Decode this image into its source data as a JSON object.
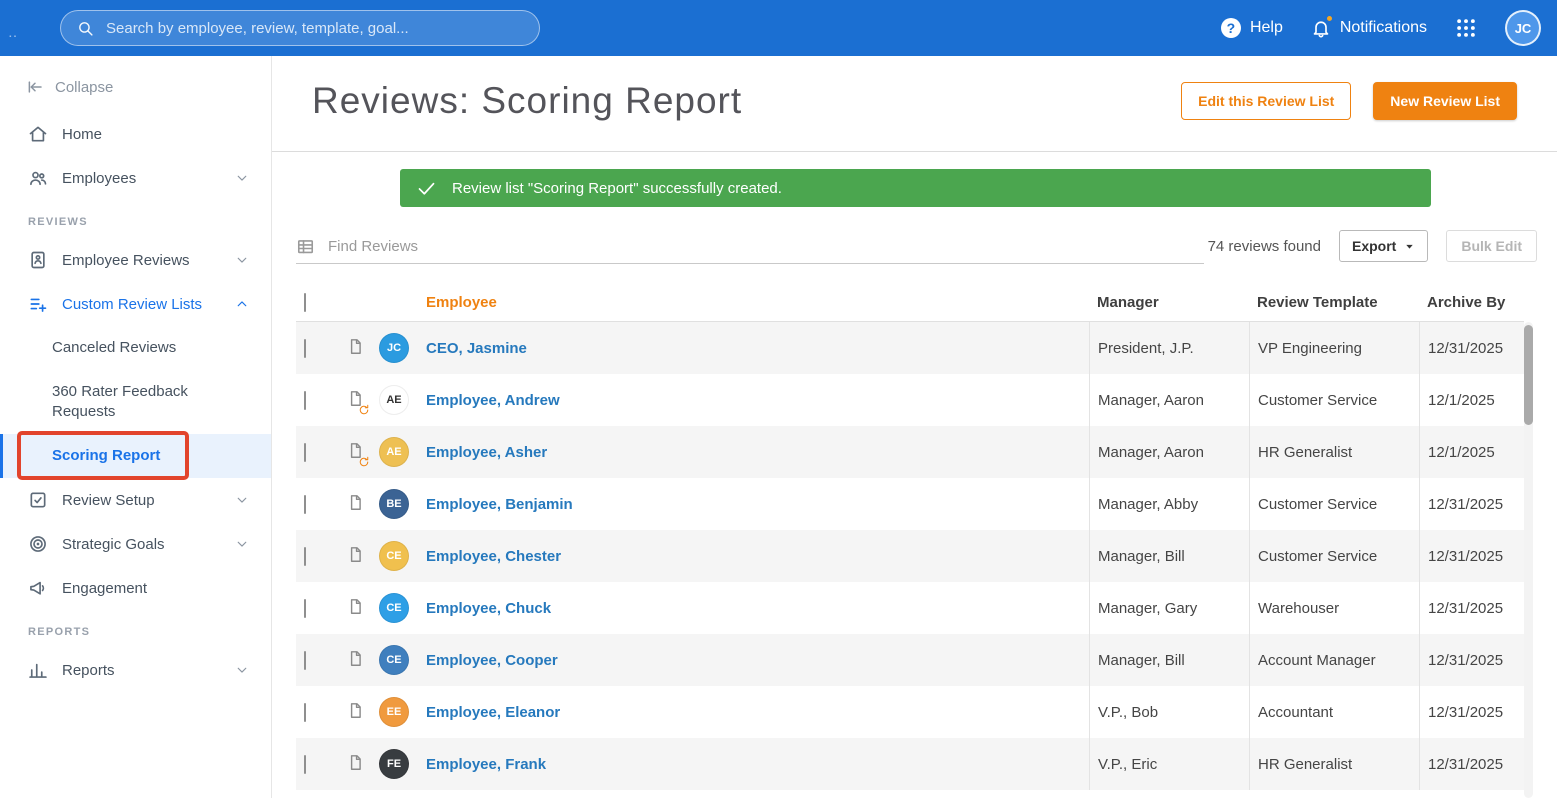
{
  "topbar": {
    "search_placeholder": "Search by employee, review, template, goal...",
    "help_label": "Help",
    "notifications_label": "Notifications",
    "avatar_initials": "JC"
  },
  "sidebar": {
    "collapse_label": "Collapse",
    "items": [
      {
        "type": "link",
        "icon": "home-icon",
        "label": "Home"
      },
      {
        "type": "link",
        "icon": "employees-icon",
        "label": "Employees",
        "chevron": "down"
      },
      {
        "type": "section",
        "label": "REVIEWS"
      },
      {
        "type": "link",
        "icon": "employee-reviews-icon",
        "label": "Employee Reviews",
        "chevron": "down"
      },
      {
        "type": "link",
        "icon": "custom-review-lists-icon",
        "label": "Custom Review Lists",
        "chevron": "up",
        "active": true
      },
      {
        "type": "sublink",
        "label": "Canceled Reviews"
      },
      {
        "type": "sublink",
        "label": "360 Rater Feedback Requests"
      },
      {
        "type": "sublink",
        "label": "Scoring Report",
        "selected": true,
        "annotated": true
      },
      {
        "type": "link",
        "icon": "review-setup-icon",
        "label": "Review Setup",
        "chevron": "down"
      },
      {
        "type": "link",
        "icon": "strategic-goals-icon",
        "label": "Strategic Goals",
        "chevron": "down"
      },
      {
        "type": "link",
        "icon": "engagement-icon",
        "label": "Engagement"
      },
      {
        "type": "section",
        "label": "REPORTS"
      },
      {
        "type": "link",
        "icon": "reports-icon",
        "label": "Reports",
        "chevron": "down"
      }
    ]
  },
  "page": {
    "title": "Reviews: Scoring Report",
    "edit_list_button": "Edit this Review List",
    "new_list_button": "New Review List",
    "success_message": "Review list \"Scoring Report\" successfully created.",
    "find_placeholder": "Find Reviews",
    "results_count": "74 reviews found",
    "export_button": "Export",
    "bulk_edit_button": "Bulk Edit"
  },
  "table": {
    "columns": [
      "Employee",
      "Manager",
      "Review Template",
      "Archive By"
    ],
    "rows": [
      {
        "name": "CEO, Jasmine",
        "initials": "JC",
        "avatar_color": "#2b9be0",
        "manager": "President, J.P.",
        "review_template": "VP Engineering",
        "archive_by": "12/31/2025",
        "doc": "default"
      },
      {
        "name": "Employee, Andrew",
        "initials": "AE",
        "avatar_color": "#ffffff",
        "avatar_text_color": "#333333",
        "manager": "Manager, Aaron",
        "review_template": "Customer Service",
        "archive_by": "12/1/2025",
        "doc": "refresh"
      },
      {
        "name": "Employee, Asher",
        "initials": "AE",
        "avatar_color": "#eec053",
        "manager": "Manager, Aaron",
        "review_template": "HR Generalist",
        "archive_by": "12/1/2025",
        "doc": "refresh"
      },
      {
        "name": "Employee, Benjamin",
        "initials": "BE",
        "avatar_color": "#3b6394",
        "manager": "Manager, Abby",
        "review_template": "Customer Service",
        "archive_by": "12/31/2025",
        "doc": "default"
      },
      {
        "name": "Employee, Chester",
        "initials": "CE",
        "avatar_color": "#f0c04e",
        "manager": "Manager, Bill",
        "review_template": "Customer Service",
        "archive_by": "12/31/2025",
        "doc": "default"
      },
      {
        "name": "Employee, Chuck",
        "initials": "CE",
        "avatar_color": "#2e9fe6",
        "manager": "Manager, Gary",
        "review_template": "Warehouser",
        "archive_by": "12/31/2025",
        "doc": "default"
      },
      {
        "name": "Employee, Cooper",
        "initials": "CE",
        "avatar_color": "#3f7fbe",
        "manager": "Manager, Bill",
        "review_template": "Account Manager",
        "archive_by": "12/31/2025",
        "doc": "default"
      },
      {
        "name": "Employee, Eleanor",
        "initials": "EE",
        "avatar_color": "#f09a3e",
        "manager": "V.P., Bob",
        "review_template": "Accountant",
        "archive_by": "12/31/2025",
        "doc": "default"
      },
      {
        "name": "Employee, Frank",
        "initials": "FE",
        "avatar_color": "#383c40",
        "manager": "V.P., Eric",
        "review_template": "HR Generalist",
        "archive_by": "12/31/2025",
        "doc": "default"
      }
    ]
  },
  "colors": {
    "topbar": "#1b6fd2",
    "accent": "#ef8211",
    "green": "#4ba64f",
    "link": "#2679bd",
    "active": "#1a73e8",
    "annotation": "#e2442c"
  }
}
